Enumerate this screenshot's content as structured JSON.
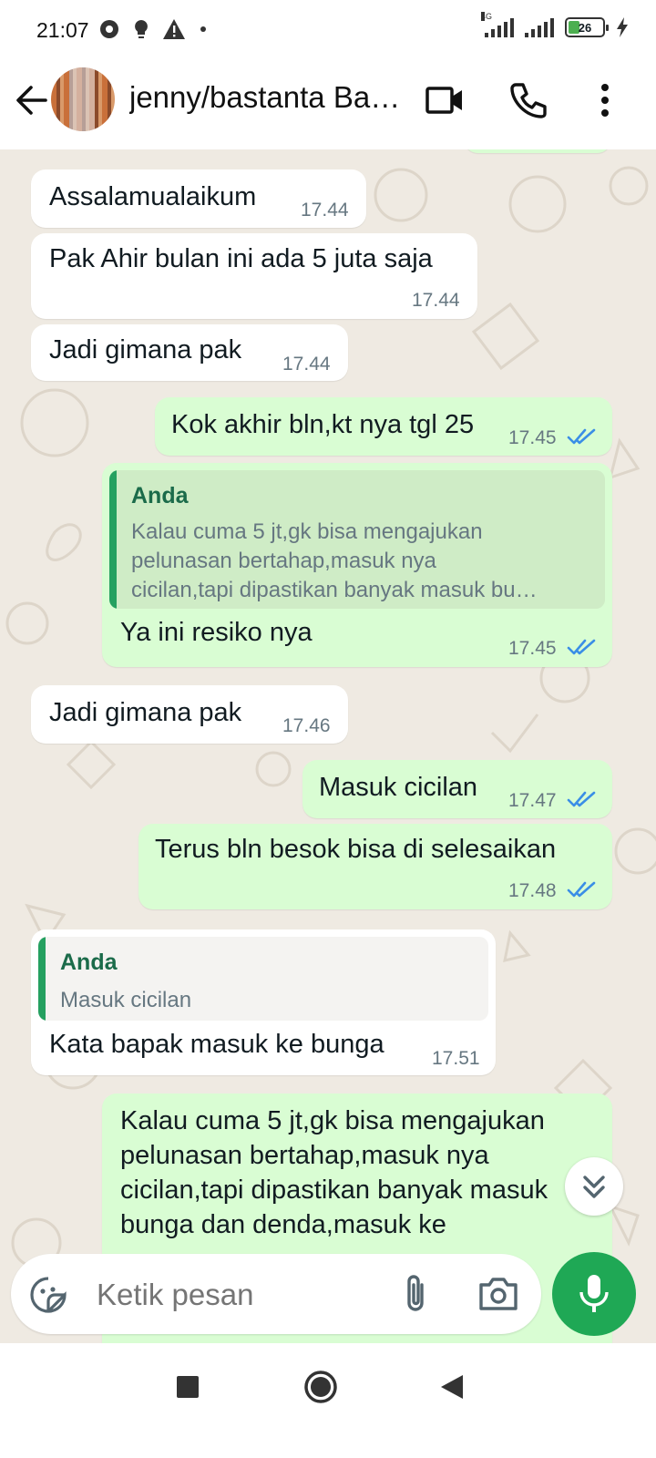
{
  "status_bar": {
    "time": "21:07",
    "network_label": "4G",
    "battery": "26"
  },
  "header": {
    "contact_name": "jenny/bastanta Ba…",
    "icons": [
      "back-arrow-icon",
      "video-call-icon",
      "voice-call-icon",
      "more-vert-icon"
    ]
  },
  "messages": [
    {
      "dir": "in",
      "text": "Assalamualaikum",
      "time": "17.44"
    },
    {
      "dir": "in",
      "text": "Pak Ahir bulan ini ada 5 juta saja",
      "time": "17.44"
    },
    {
      "dir": "in",
      "text": "Jadi gimana pak",
      "time": "17.44"
    },
    {
      "dir": "out",
      "text": "Kok akhir bln,kt nya tgl 25",
      "time": "17.45",
      "status": "read"
    },
    {
      "dir": "out",
      "text": "Ya ini resiko nya",
      "time": "17.45",
      "status": "read",
      "quote": {
        "sender": "Anda",
        "lines": [
          "Kalau cuma 5 jt,gk bisa mengajukan",
          "pelunasan bertahap,masuk nya",
          "cicilan,tapi dipastikan banyak masuk bu…"
        ]
      }
    },
    {
      "dir": "in",
      "text": "Jadi gimana pak",
      "time": "17.46"
    },
    {
      "dir": "out",
      "text": "Masuk cicilan",
      "time": "17.47",
      "status": "read"
    },
    {
      "dir": "out",
      "text": "Terus bln besok bisa di selesaikan",
      "time": "17.48",
      "status": "read"
    },
    {
      "dir": "in",
      "text": "Kata bapak masuk ke bunga",
      "time": "17.51",
      "quote": {
        "sender": "Anda",
        "lines": [
          "Masuk cicilan"
        ]
      }
    },
    {
      "dir": "out",
      "lines": [
        "Kalau cuma 5 jt,gk bisa mengajukan",
        "pelunasan bertahap,masuk nya",
        "cicilan,tapi dipastikan banyak masuk",
        "bunga dan denda,masuk ke"
      ]
    }
  ],
  "composer": {
    "placeholder": "Ketik pesan"
  },
  "colors": {
    "chat_bg": "#efeae2",
    "incoming": "#ffffff",
    "outgoing": "#d9fdd3",
    "read_ticks": "#3a8ee6",
    "accent": "#1fa855"
  }
}
